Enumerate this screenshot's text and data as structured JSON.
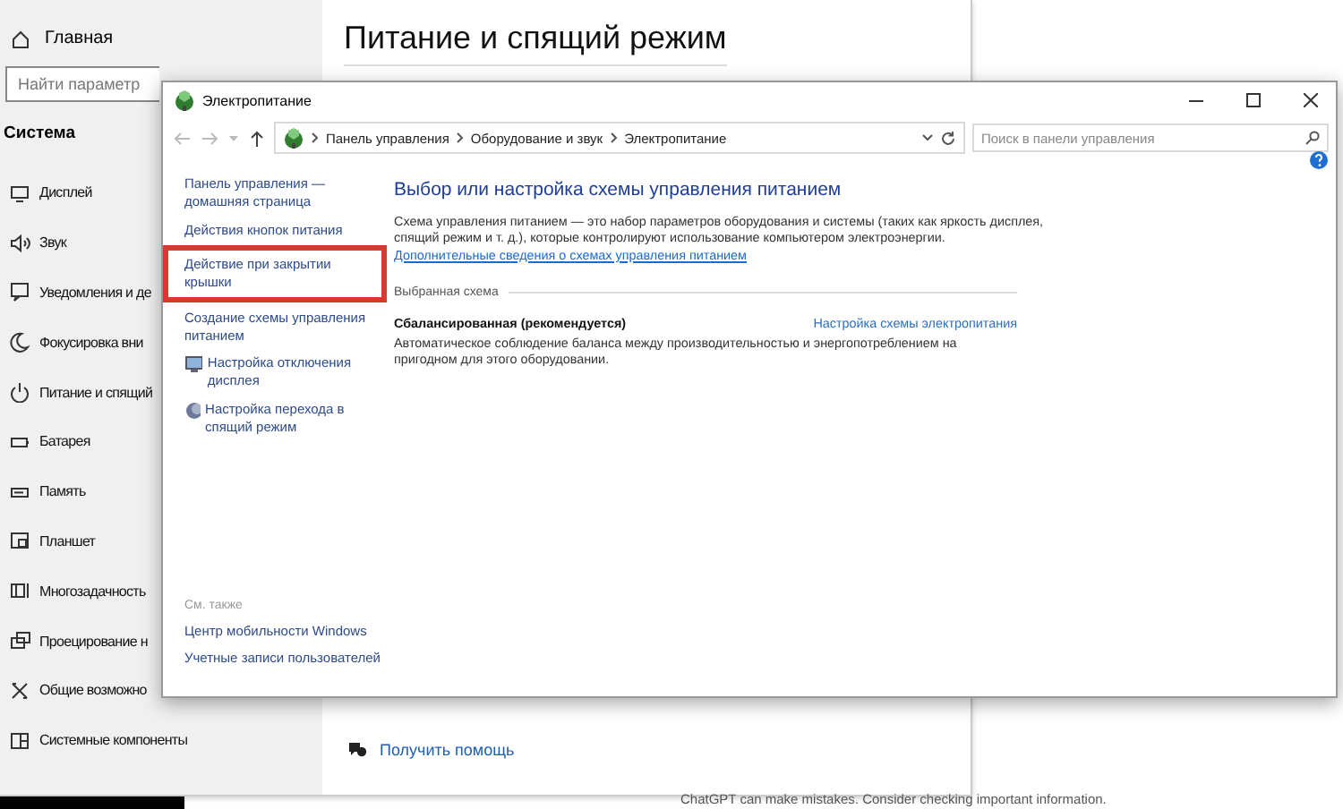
{
  "settings": {
    "home": "Главная",
    "search": {
      "placeholder": "Найти параметр"
    },
    "section": "Система",
    "items": [
      {
        "label": "Дисплей"
      },
      {
        "label": "Звук"
      },
      {
        "label": "Уведомления и де"
      },
      {
        "label": "Фокусировка вни"
      },
      {
        "label": "Питание и спящий"
      },
      {
        "label": "Батарея"
      },
      {
        "label": "Память"
      },
      {
        "label": "Планшет"
      },
      {
        "label": "Многозадачность"
      },
      {
        "label": "Проецирование н"
      },
      {
        "label": "Общие возможно"
      },
      {
        "label": "Системные компоненты"
      }
    ],
    "page_title": "Питание и спящий режим",
    "help_link": "Получить помощь"
  },
  "control_panel": {
    "title": "Электропитание",
    "breadcrumbs": [
      "Панель управления",
      "Оборудование и звук",
      "Электропитание"
    ],
    "search": {
      "placeholder": "Поиск в панели управления"
    },
    "nav": [
      {
        "label": "Панель управления — домашняя страница",
        "kind": "link",
        "highlighted": false
      },
      {
        "label": "Действия кнопок питания",
        "kind": "link",
        "highlighted": false
      },
      {
        "label": "Действие при закрытии крышки",
        "kind": "link",
        "highlighted": true
      },
      {
        "label": "Создание схемы управления питанием",
        "kind": "link",
        "highlighted": false
      },
      {
        "label": "Настройка отключения дисплея",
        "kind": "display",
        "highlighted": false
      },
      {
        "label": "Настройка перехода в спящий режим",
        "kind": "sleep",
        "highlighted": false
      }
    ],
    "see_also_title": "См. также",
    "see_also": [
      "Центр мобильности Windows",
      "Учетные записи пользователей"
    ],
    "heading": "Выбор или настройка схемы управления питанием",
    "description": "Схема управления питанием — это набор параметров оборудования и системы (таких как яркость дисплея, спящий режим и т. д.), которые контролируют использование компьютером электроэнергии.",
    "more_link": "Дополнительные сведения о схемах управления питанием",
    "section_label": "Выбранная схема",
    "plan": {
      "name": "Сбалансированная (рекомендуется)",
      "settings_link": "Настройка схемы электропитания",
      "description": "Автоматическое соблюдение баланса между производительностью и энергопотреблением на пригодном для этого оборудовании."
    }
  },
  "footer_note": "ChatGPT can make mistakes. Consider checking important information."
}
